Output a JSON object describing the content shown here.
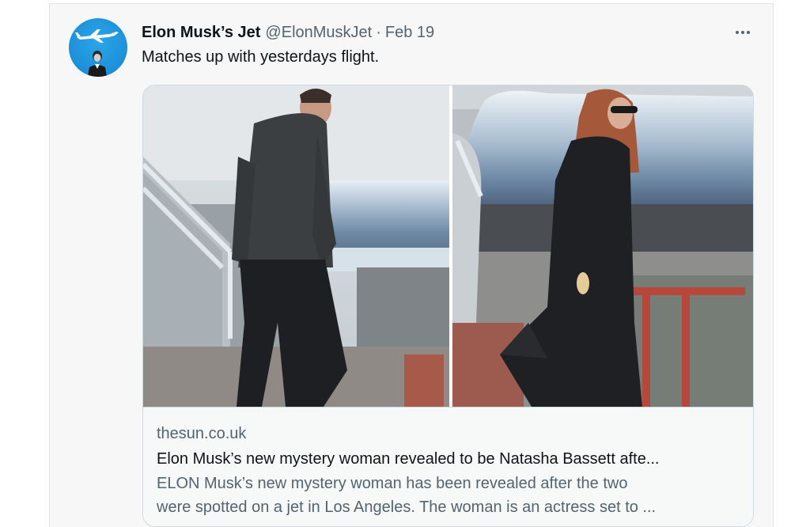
{
  "tweet": {
    "display_name": "Elon Musk’s Jet",
    "handle": "@ElonMuskJet",
    "separator": "·",
    "date": "Feb 19",
    "text": "Matches up with yesterdays flight.",
    "avatar_icon": "jet-plane-icon",
    "more_icon": "more-options-icon"
  },
  "card": {
    "domain": "thesun.co.uk",
    "title": "Elon Musk’s new mystery woman revealed to be Natasha Bassett afte...",
    "description_line1": "ELON Musk’s new mystery woman has been revealed after the two",
    "description_line2": "were spotted on a jet in Los Angeles. The woman is an actress set to ...",
    "images": [
      "man-boarding-jet-photo",
      "woman-boarding-jet-photo"
    ]
  },
  "colors": {
    "accent": "#1d9bf0",
    "text_primary": "#0f1419",
    "text_secondary": "#536471",
    "border": "#cfd9de"
  }
}
